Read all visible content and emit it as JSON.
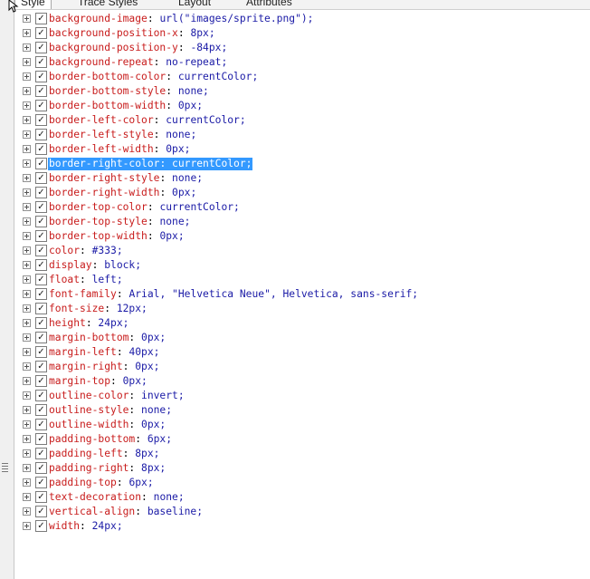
{
  "tabs": [
    "Style",
    "Trace Styles",
    "Layout",
    "Attributes"
  ],
  "checkmark": "✓",
  "properties": [
    {
      "name": "background-image",
      "value": "url(\"images/sprite.png\");"
    },
    {
      "name": "background-position-x",
      "value": "8px;"
    },
    {
      "name": "background-position-y",
      "value": "-84px;"
    },
    {
      "name": "background-repeat",
      "value": "no-repeat;"
    },
    {
      "name": "border-bottom-color",
      "value": "currentColor;"
    },
    {
      "name": "border-bottom-style",
      "value": "none;"
    },
    {
      "name": "border-bottom-width",
      "value": "0px;"
    },
    {
      "name": "border-left-color",
      "value": "currentColor;"
    },
    {
      "name": "border-left-style",
      "value": "none;"
    },
    {
      "name": "border-left-width",
      "value": "0px;"
    },
    {
      "name": "border-right-color",
      "value": "currentColor;",
      "selected": true
    },
    {
      "name": "border-right-style",
      "value": "none;"
    },
    {
      "name": "border-right-width",
      "value": "0px;"
    },
    {
      "name": "border-top-color",
      "value": "currentColor;"
    },
    {
      "name": "border-top-style",
      "value": "none;"
    },
    {
      "name": "border-top-width",
      "value": "0px;"
    },
    {
      "name": "color",
      "value": "#333;"
    },
    {
      "name": "display",
      "value": "block;"
    },
    {
      "name": "float",
      "value": "left;"
    },
    {
      "name": "font-family",
      "value": "Arial, \"Helvetica Neue\", Helvetica, sans-serif;"
    },
    {
      "name": "font-size",
      "value": "12px;"
    },
    {
      "name": "height",
      "value": "24px;"
    },
    {
      "name": "margin-bottom",
      "value": "0px;"
    },
    {
      "name": "margin-left",
      "value": "40px;"
    },
    {
      "name": "margin-right",
      "value": "0px;"
    },
    {
      "name": "margin-top",
      "value": "0px;"
    },
    {
      "name": "outline-color",
      "value": "invert;"
    },
    {
      "name": "outline-style",
      "value": "none;"
    },
    {
      "name": "outline-width",
      "value": "0px;"
    },
    {
      "name": "padding-bottom",
      "value": "6px;"
    },
    {
      "name": "padding-left",
      "value": "8px;"
    },
    {
      "name": "padding-right",
      "value": "8px;"
    },
    {
      "name": "padding-top",
      "value": "6px;"
    },
    {
      "name": "text-decoration",
      "value": "none;"
    },
    {
      "name": "vertical-align",
      "value": "baseline;"
    },
    {
      "name": "width",
      "value": "24px;"
    }
  ]
}
